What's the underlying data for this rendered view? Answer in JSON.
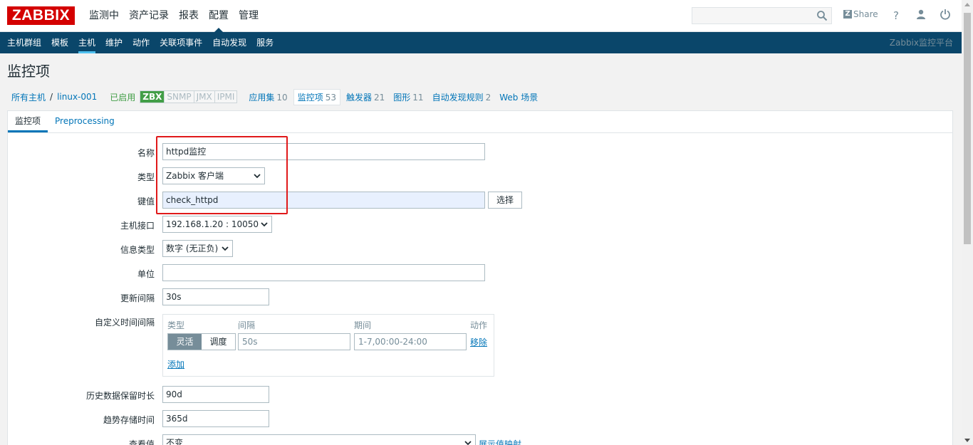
{
  "header": {
    "logo": "ZABBIX",
    "nav": [
      "监测中",
      "资产记录",
      "报表",
      "配置",
      "管理"
    ],
    "active_nav": "配置",
    "search_placeholder": "",
    "share": "Share",
    "help_icon": "?",
    "user_icon": "user-icon",
    "power_icon": "power-icon"
  },
  "subnav": {
    "items": [
      "主机群组",
      "模板",
      "主机",
      "维护",
      "动作",
      "关联项事件",
      "自动发现",
      "服务"
    ],
    "active": "主机",
    "platform": "Zabbix监控平台"
  },
  "page": {
    "title": "监控项"
  },
  "breadcrumb": {
    "all_hosts": "所有主机",
    "separator": "/",
    "host": "linux-001",
    "enabled": "已启用",
    "availability": [
      "ZBX",
      "SNMP",
      "JMX",
      "IPMI"
    ],
    "tabs": [
      {
        "label": "应用集",
        "count": "10"
      },
      {
        "label": "监控项",
        "count": "53"
      },
      {
        "label": "触发器",
        "count": "21"
      },
      {
        "label": "图形",
        "count": "11"
      },
      {
        "label": "自动发现规则",
        "count": "2"
      },
      {
        "label": "Web 场景",
        "count": ""
      }
    ]
  },
  "form": {
    "tabs": [
      "监控项",
      "Preprocessing"
    ],
    "name_label": "名称",
    "name_value": "httpd监控",
    "type_label": "类型",
    "type_value": "Zabbix 客户端",
    "key_label": "键值",
    "key_value": "check_httpd",
    "select_button": "选择",
    "interface_label": "主机接口",
    "interface_value": "192.168.1.20 : 10050",
    "info_type_label": "信息类型",
    "info_type_value": "数字 (无正负)",
    "units_label": "单位",
    "units_value": "",
    "interval_label": "更新间隔",
    "interval_value": "30s",
    "custom_label": "自定义时间间隔",
    "custom": {
      "col_type": "类型",
      "col_interval": "间隔",
      "col_period": "期间",
      "col_action": "动作",
      "seg_flexible": "灵活",
      "seg_scheduling": "调度",
      "interval_placeholder": "50s",
      "period_placeholder": "1-7,00:00-24:00",
      "remove": "移除",
      "add": "添加"
    },
    "history_label": "历史数据保留时长",
    "history_value": "90d",
    "trends_label": "趋势存储时间",
    "trends_value": "365d",
    "show_value_label": "查看值",
    "show_value_value": "不变",
    "value_mapping_link": "展示值映射"
  },
  "colors": {
    "brand": "#d40000",
    "subnav_bg": "#0a466a",
    "link": "#0275b8",
    "enabled": "#429e47",
    "highlight_box": "#e0191a"
  }
}
